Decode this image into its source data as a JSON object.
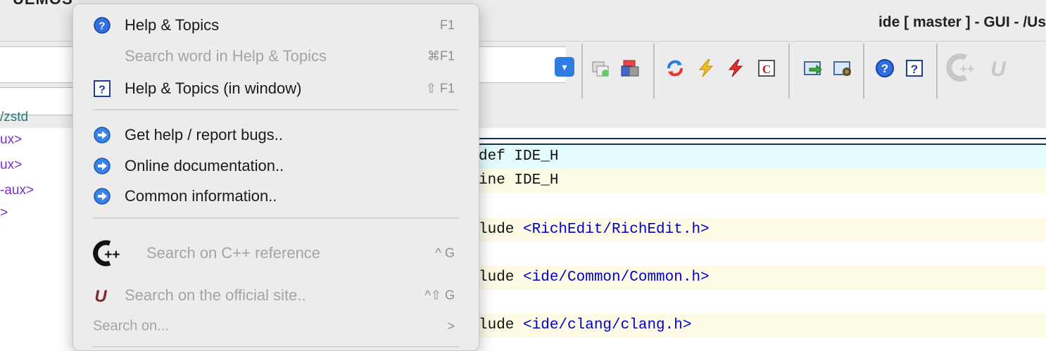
{
  "window": {
    "title": "ide [ master ]  - GUI - /Us",
    "clipped_top_text": "UEMOS"
  },
  "workspace": {
    "items": [
      {
        "text": "/zstd",
        "color": "#2a7a7a"
      },
      {
        "text": "ux>",
        "color": "#7b2fd0"
      },
      {
        "text": "ux>",
        "color": "#7b2fd0"
      },
      {
        "text": "-aux>",
        "color": "#7b2fd0"
      },
      {
        "text": ">",
        "color": "#7b2fd0"
      }
    ]
  },
  "toolbar": {
    "icons": [
      "build-icon",
      "build-colored-icon",
      "refresh-icon",
      "lightning-yellow-icon",
      "lightning-red-icon",
      "c-box-icon",
      "arrow-window-icon",
      "debug-window-icon",
      "help-circle-icon",
      "help-box-icon",
      "cpp-logo-icon",
      "u-logo-icon"
    ]
  },
  "editor": {
    "lines": [
      {
        "pre": "def ",
        "rest": "IDE_H",
        "style": "cyan"
      },
      {
        "pre": "ine ",
        "rest": "IDE_H",
        "style": "yellow"
      },
      {
        "pre": "",
        "rest": "",
        "style": "none"
      },
      {
        "pre": "lude ",
        "rest": "<RichEdit/RichEdit.h>",
        "style": "yellow"
      },
      {
        "pre": "",
        "rest": "",
        "style": "none"
      },
      {
        "pre": "lude ",
        "rest": "<ide/Common/Common.h>",
        "style": "yellow"
      },
      {
        "pre": "",
        "rest": "",
        "style": "none"
      },
      {
        "pre": "lude ",
        "rest": "<ide/clang/clang.h>",
        "style": "yellow"
      }
    ]
  },
  "menu": {
    "help_topics": {
      "label": "Help & Topics",
      "shortcut": "F1"
    },
    "search_word": {
      "label": "Search word in Help & Topics",
      "shortcut": "⌘F1"
    },
    "help_window": {
      "label": "Help & Topics (in window)",
      "shortcut": "⇧ F1"
    },
    "report_bugs": {
      "label": "Get help / report bugs.."
    },
    "online_docs": {
      "label": "Online documentation.."
    },
    "common_info": {
      "label": "Common information.."
    },
    "cpp_reference": {
      "label": "Search on C++ reference",
      "shortcut": "^ G"
    },
    "official_site": {
      "label": "Search on the official site..",
      "shortcut": "^⇧ G"
    },
    "search_on": {
      "label": "Search on...",
      "shortcut": ">"
    }
  },
  "colors": {
    "help_blue": "#2f6fe0",
    "arrow_blue": "#3b82e8",
    "menu_bg": "#ececec"
  }
}
